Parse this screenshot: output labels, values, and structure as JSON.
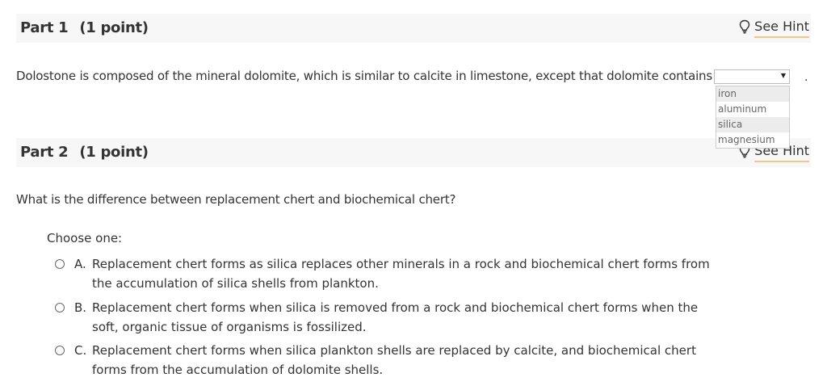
{
  "part1": {
    "label": "Part 1",
    "points": "(1 point)",
    "hint": "See Hint",
    "question": "Dolostone is composed of the mineral dolomite, which is similar to calcite in limestone, except that dolomite contains",
    "dropdown": {
      "selected": "",
      "options": [
        "iron",
        "aluminum",
        "silica",
        "magnesium"
      ]
    },
    "trailing": "."
  },
  "part2": {
    "label": "Part 2",
    "points": "(1 point)",
    "hint": "See Hint",
    "question": "What is the difference between replacement chert and biochemical chert?",
    "choose_label": "Choose one:",
    "options": [
      {
        "letter": "A.",
        "text": "Replacement chert forms as silica replaces other minerals in a rock and biochemical chert forms from the accumulation of silica shells from plankton."
      },
      {
        "letter": "B.",
        "text": "Replacement chert forms when silica is removed from a rock and biochemical chert forms when the soft, organic tissue of organisms is fossilized."
      },
      {
        "letter": "C.",
        "text": "Replacement chert forms when silica plankton shells are replaced by calcite, and biochemical chert forms from the accumulation of dolomite shells."
      }
    ]
  },
  "icons": {
    "hint": "lightbulb-icon"
  },
  "colors": {
    "header_bg": "#f7f7f7",
    "hint_underline": "#f0c987"
  }
}
